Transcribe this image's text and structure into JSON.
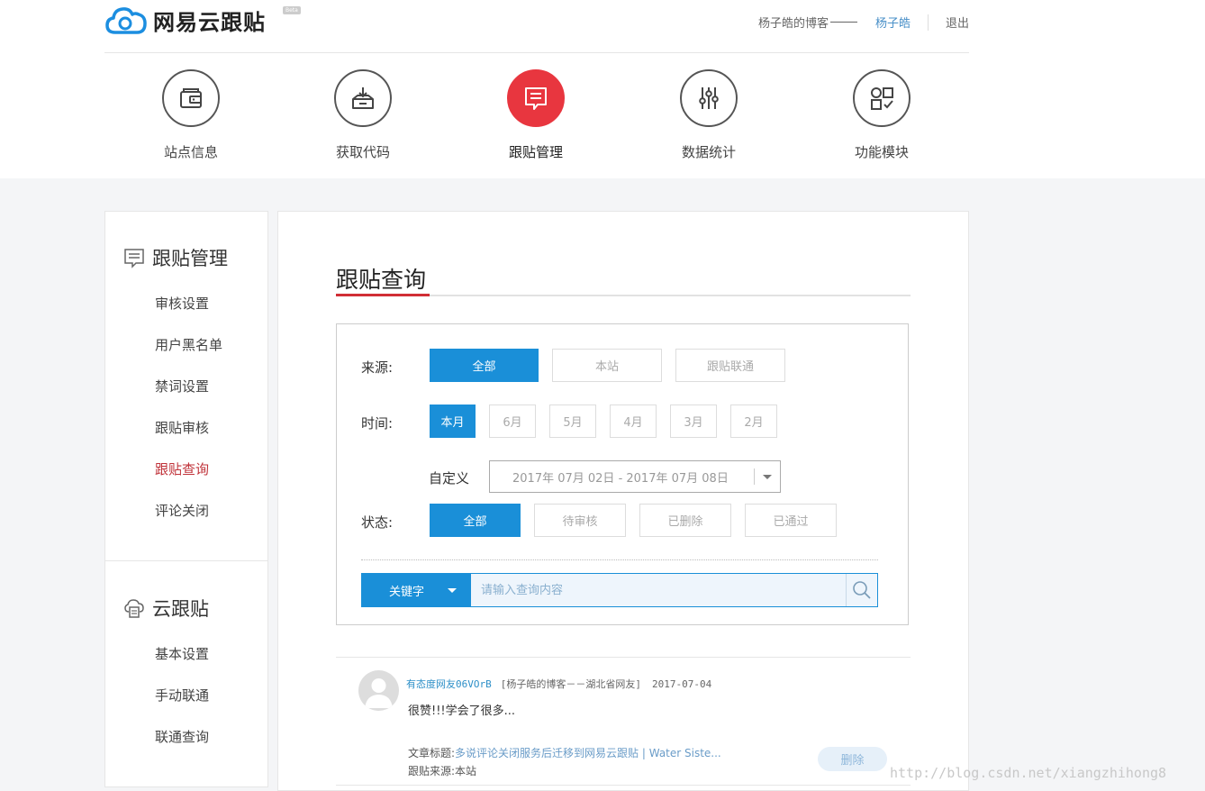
{
  "header": {
    "logo_text": "网易云跟贴",
    "beta": "Beta",
    "blog_name": "杨子皓的博客",
    "user_name": "杨子皓",
    "logout": "退出"
  },
  "nav": [
    {
      "label": "站点信息",
      "icon": "wallet-icon"
    },
    {
      "label": "获取代码",
      "icon": "download-box-icon"
    },
    {
      "label": "跟贴管理",
      "icon": "comment-icon",
      "active": true
    },
    {
      "label": "数据统计",
      "icon": "sliders-icon"
    },
    {
      "label": "功能模块",
      "icon": "modules-icon"
    }
  ],
  "sidebar": {
    "section1": {
      "title": "跟贴管理",
      "items": [
        "审核设置",
        "用户黑名单",
        "禁词设置",
        "跟贴审核",
        "跟贴查询",
        "评论关闭"
      ],
      "active": "跟贴查询"
    },
    "section2": {
      "title": "云跟贴",
      "items": [
        "基本设置",
        "手动联通",
        "联通查询"
      ]
    }
  },
  "main": {
    "title": "跟贴查询",
    "filter": {
      "source_label": "来源:",
      "source_options": [
        "全部",
        "本站",
        "跟贴联通"
      ],
      "time_label": "时间:",
      "time_options": [
        "本月",
        "6月",
        "5月",
        "4月",
        "3月",
        "2月"
      ],
      "custom_label": "自定义",
      "date_range": "2017年 07月 02日 - 2017年 07月 08日",
      "status_label": "状态:",
      "status_options": [
        "全部",
        "待审核",
        "已删除",
        "已通过"
      ],
      "keyword_label": "关键字",
      "search_placeholder": "请输入查询内容"
    },
    "comment": {
      "user": "有态度网友06VOrB",
      "from": "[杨子皓的博客－－湖北省网友]",
      "date": "2017-07-04",
      "text": "很赞!!!学会了很多...",
      "title_label": "文章标题:",
      "title_value": "多说评论关闭服务后迁移到网易云跟贴 | Water Siste...",
      "source_label": "跟贴来源:",
      "source_value": "本站",
      "delete": "删除"
    }
  },
  "watermark": "http://blog.csdn.net/xiangzhihong8",
  "colors": {
    "accent": "#1a8fd8",
    "active_red": "#e8363f",
    "title_red": "#d12e35"
  }
}
